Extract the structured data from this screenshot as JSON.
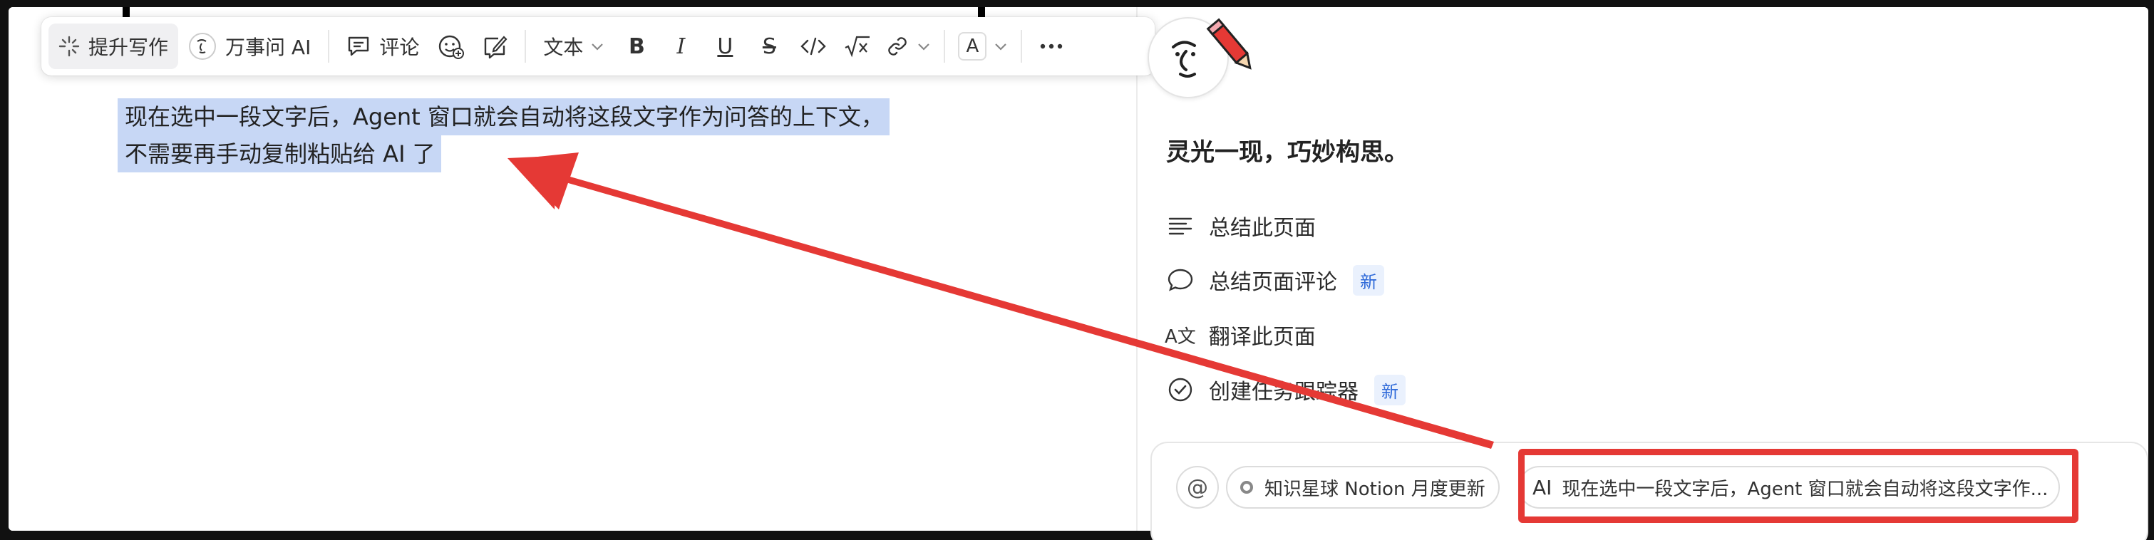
{
  "toolbar": {
    "improve_writing": "提升写作",
    "ask_ai": "万事问 AI",
    "comment": "评论",
    "text_style": "文本",
    "color_letter": "A",
    "icons": [
      "sparkle-icon",
      "ai-face-icon",
      "comment-icon",
      "emoji-add-icon",
      "edit-note-icon",
      "chevron-down-icon",
      "bold-icon",
      "italic-icon",
      "underline-icon",
      "strikethrough-icon",
      "code-icon",
      "equation-icon",
      "link-icon",
      "text-color-icon",
      "more-icon"
    ]
  },
  "editor": {
    "selected_line_1": "现在选中一段文字后，Agent 窗口就会自动将这段文字作为问答的上下文，",
    "selected_line_2": "不需要再手动复制粘贴给 AI 了",
    "highlight_color": "#c7d7f5"
  },
  "panel": {
    "headline": "灵光一现，巧妙构思。",
    "menu": [
      {
        "label": "总结此页面",
        "icon": "lines-icon",
        "badge": ""
      },
      {
        "label": "总结页面评论",
        "icon": "chat-bubble-icon",
        "badge": "新"
      },
      {
        "label": "翻译此页面",
        "icon": "translate-icon",
        "icon_text": "A文",
        "badge": ""
      },
      {
        "label": "创建任务跟踪器",
        "icon": "check-circle-icon",
        "badge": "新"
      }
    ],
    "input": {
      "at_symbol": "@",
      "source_chip": "知识星球 Notion 月度更新",
      "context_prefix": "AI",
      "context_chip": "现在选中一段文字后，Agent 窗口就会自动将这段文字作..."
    }
  },
  "annotation": {
    "color": "#e53935"
  }
}
